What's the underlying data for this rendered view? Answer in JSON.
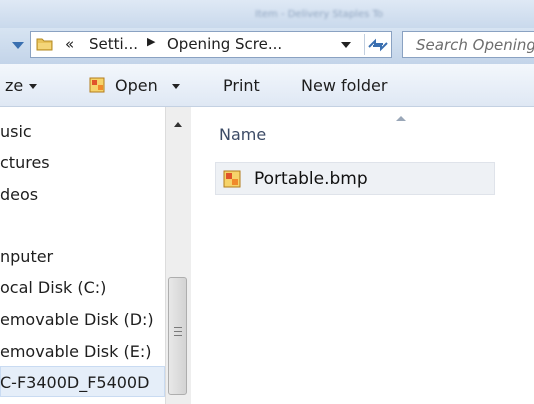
{
  "window": {
    "title": "Item - Delivery Staples To"
  },
  "address": {
    "overflow": "«",
    "crumbs": [
      "Setti...",
      "Opening Scre..."
    ],
    "separator": "▶"
  },
  "search": {
    "placeholder": "Search Opening"
  },
  "toolbar": {
    "organize_label": "ze",
    "open_label": "Open",
    "print_label": "Print",
    "new_folder_label": "New folder"
  },
  "navigation": {
    "items": [
      "usic",
      "ctures",
      "deos",
      "nputer",
      "ocal Disk (C:)",
      "emovable Disk (D:)",
      "emovable Disk (E:)",
      "C-F3400D_F5400D"
    ],
    "selected_index": 7
  },
  "content": {
    "column_header": "Name",
    "files": [
      {
        "name": "Portable.bmp",
        "icon": "bmp-file-icon"
      }
    ]
  },
  "colors": {
    "accent": "#3a6fb0",
    "selected_bg": "#e5eef9",
    "file_row_bg": "#eef1f5"
  }
}
